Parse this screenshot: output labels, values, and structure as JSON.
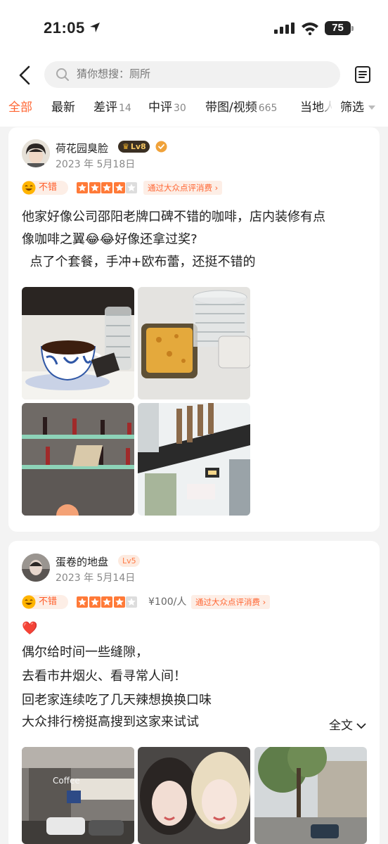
{
  "status": {
    "time": "21:05",
    "battery": "75"
  },
  "search": {
    "placeholder": "猜你想搜：厕所"
  },
  "tabs": [
    {
      "label": "全部",
      "count": ""
    },
    {
      "label": "最新",
      "count": ""
    },
    {
      "label": "差评",
      "count": "14"
    },
    {
      "label": "中评",
      "count": "30"
    },
    {
      "label": "带图/视频",
      "count": "665"
    },
    {
      "label": "当地人",
      "count": ""
    }
  ],
  "filter_label": "筛选",
  "reviews": [
    {
      "username": "荷花园臭脸",
      "level": "Lv8",
      "date": "2023 年 5月18日",
      "mood": "不错",
      "stars": 4,
      "source_tag": "通过大众点评消费",
      "lines": [
        "他家好像公司邵阳老牌口碑不错的咖啡，店内装修有点",
        "像咖啡之翼😂😂好像还拿过奖?",
        "  点了个套餐，手冲+欧布蕾，还挺不错的"
      ]
    },
    {
      "username": "蛋卷的地盘",
      "level": "Lv5",
      "date": "2023 年 5月14日",
      "mood": "不错",
      "stars": 4,
      "price": "¥100/人",
      "source_tag": "通过大众点评消费",
      "heart": "❤️",
      "lines": [
        "偶尔给时间一些缝隙，",
        "去看市井烟火、看寻常人间！",
        "回老家连续吃了几天辣想换换口味",
        "大众排行榜挺高搜到这家来试试"
      ],
      "expand_label": "全文",
      "photo_text": "Coffee"
    }
  ],
  "colors": {
    "accent": "#ff6633",
    "star": "#ff7a38"
  }
}
